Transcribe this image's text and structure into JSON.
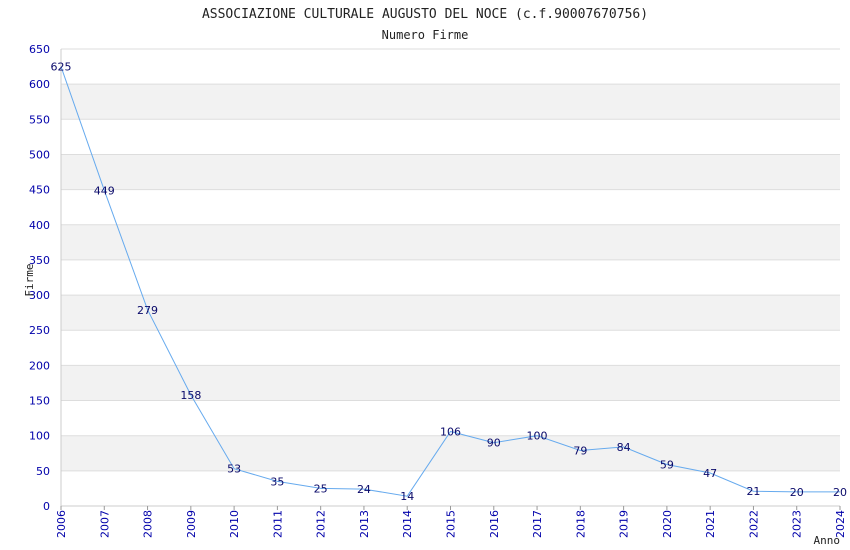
{
  "chart_data": {
    "type": "line",
    "title": "ASSOCIAZIONE CULTURALE AUGUSTO DEL NOCE (c.f.90007670756)",
    "subtitle": "Numero Firme",
    "xlabel": "Anno",
    "ylabel": "Firme",
    "x": [
      "2006",
      "2007",
      "2008",
      "2009",
      "2010",
      "2011",
      "2012",
      "2013",
      "2014",
      "2015",
      "2016",
      "2017",
      "2018",
      "2019",
      "2020",
      "2021",
      "2022",
      "2023",
      "2024"
    ],
    "series": [
      {
        "values": [
          625,
          449,
          279,
          158,
          53,
          35,
          25,
          24,
          14,
          106,
          90,
          100,
          79,
          84,
          59,
          47,
          21,
          20,
          20
        ]
      }
    ],
    "ylim": [
      0,
      650
    ],
    "yticks": [
      "0",
      "50",
      "100",
      "150",
      "200",
      "250",
      "300",
      "350",
      "400",
      "450",
      "500",
      "550",
      "600",
      "650"
    ],
    "grid": true,
    "line_color": "#66aaee",
    "band_color": "#f2f2f2",
    "tick_color": "#0000aa"
  }
}
